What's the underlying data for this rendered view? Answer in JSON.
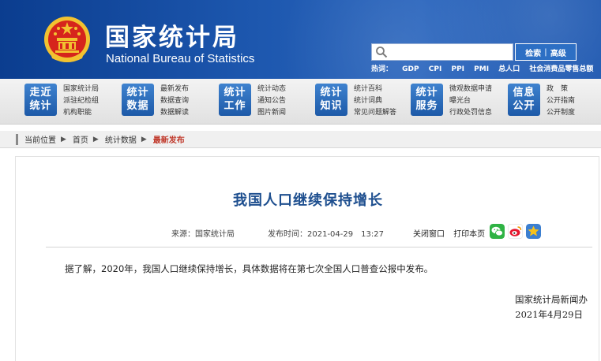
{
  "header": {
    "title_cn": "国家统计局",
    "title_en": "National Bureau of Statistics",
    "search": {
      "placeholder": "",
      "search_label": "检索",
      "advanced_label": "高级"
    },
    "hot_label": "热词：",
    "hot_links": [
      "GDP",
      "CPI",
      "PPI",
      "PMI",
      "总人口",
      "社会消费品零售总额"
    ]
  },
  "nav": [
    {
      "tile_top": "走近",
      "tile_bottom": "统计",
      "links": [
        "国家统计局",
        "派驻纪检组",
        "机构职能"
      ]
    },
    {
      "tile_top": "统计",
      "tile_bottom": "数据",
      "links": [
        "最新发布",
        "数据查询",
        "数据解读"
      ]
    },
    {
      "tile_top": "统计",
      "tile_bottom": "工作",
      "links": [
        "统计动态",
        "通知公告",
        "图片新闻"
      ]
    },
    {
      "tile_top": "统计",
      "tile_bottom": "知识",
      "links": [
        "统计百科",
        "统计词典",
        "常见问题解答"
      ]
    },
    {
      "tile_top": "统计",
      "tile_bottom": "服务",
      "links": [
        "微观数据申请",
        "曝光台",
        "行政处罚信息"
      ]
    },
    {
      "tile_top": "信息",
      "tile_bottom": "公开",
      "links": [
        "政　策",
        "公开指南",
        "公开制度"
      ]
    }
  ],
  "breadcrumb": {
    "label": "当前位置",
    "items": [
      "首页",
      "统计数据"
    ],
    "current": "最新发布"
  },
  "article": {
    "title": "我国人口继续保持增长",
    "source_label": "来源：",
    "source": "国家统计局",
    "time_label": "发布时间：",
    "time": "2021-04-29　13:27",
    "close_label": "关闭窗口",
    "print_label": "打印本页",
    "body": "据了解，2020年，我国人口继续保持增长，具体数据将在第七次全国人口普查公报中发布。",
    "signature": "国家统计局新闻办",
    "date": "2021年4月29日"
  },
  "colors": {
    "banner": "#1c56ad",
    "tile": "#2a6bbd",
    "title": "#1e4f8f",
    "current_crumb": "#c0392b"
  },
  "icons": [
    "emblem-icon",
    "search-icon",
    "wechat-icon",
    "weibo-icon",
    "favorite-icon"
  ]
}
